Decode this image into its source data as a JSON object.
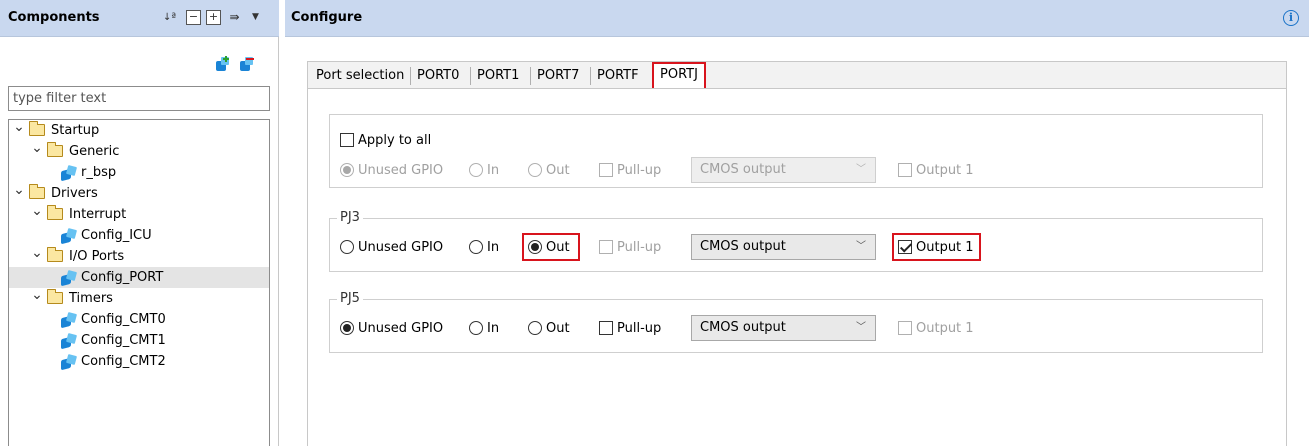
{
  "components_panel": {
    "title": "Components",
    "filter_placeholder": "type filter text",
    "tree": [
      {
        "label": "Startup",
        "kind": "folder",
        "level": 0
      },
      {
        "label": "Generic",
        "kind": "folder",
        "level": 1
      },
      {
        "label": "r_bsp",
        "kind": "component",
        "level": 2
      },
      {
        "label": "Drivers",
        "kind": "folder",
        "level": 0
      },
      {
        "label": "Interrupt",
        "kind": "folder",
        "level": 1
      },
      {
        "label": "Config_ICU",
        "kind": "component",
        "level": 2
      },
      {
        "label": "I/O Ports",
        "kind": "folder",
        "level": 1
      },
      {
        "label": "Config_PORT",
        "kind": "component",
        "level": 2,
        "selected": true
      },
      {
        "label": "Timers",
        "kind": "folder",
        "level": 1
      },
      {
        "label": "Config_CMT0",
        "kind": "component",
        "level": 2
      },
      {
        "label": "Config_CMT1",
        "kind": "component",
        "level": 2
      },
      {
        "label": "Config_CMT2",
        "kind": "component",
        "level": 2
      }
    ]
  },
  "configure_panel": {
    "title": "Configure",
    "tabs": [
      "Port selection",
      "PORT0",
      "PORT1",
      "PORT7",
      "PORTF",
      "PORTJ"
    ],
    "active_tab": "PORTJ",
    "apply_all": {
      "apply_to_all_label": "Apply to all",
      "unused_gpio": "Unused GPIO",
      "in": "In",
      "out": "Out",
      "pull_up": "Pull-up",
      "output_mode": "CMOS output",
      "output1": "Output 1"
    },
    "pj3": {
      "title": "PJ3",
      "unused_gpio": "Unused GPIO",
      "in": "In",
      "out": "Out",
      "selected": "Out",
      "pull_up": "Pull-up",
      "output_mode": "CMOS output",
      "output1": "Output 1",
      "output1_checked": true
    },
    "pj5": {
      "title": "PJ5",
      "unused_gpio": "Unused GPIO",
      "in": "In",
      "out": "Out",
      "selected": "Unused GPIO",
      "pull_up": "Pull-up",
      "output_mode": "CMOS output",
      "output1": "Output 1"
    }
  },
  "colors": {
    "header_bg": "#c9d8ef",
    "highlight_red": "#d8141d",
    "selected_row": "#e4e4e4"
  }
}
